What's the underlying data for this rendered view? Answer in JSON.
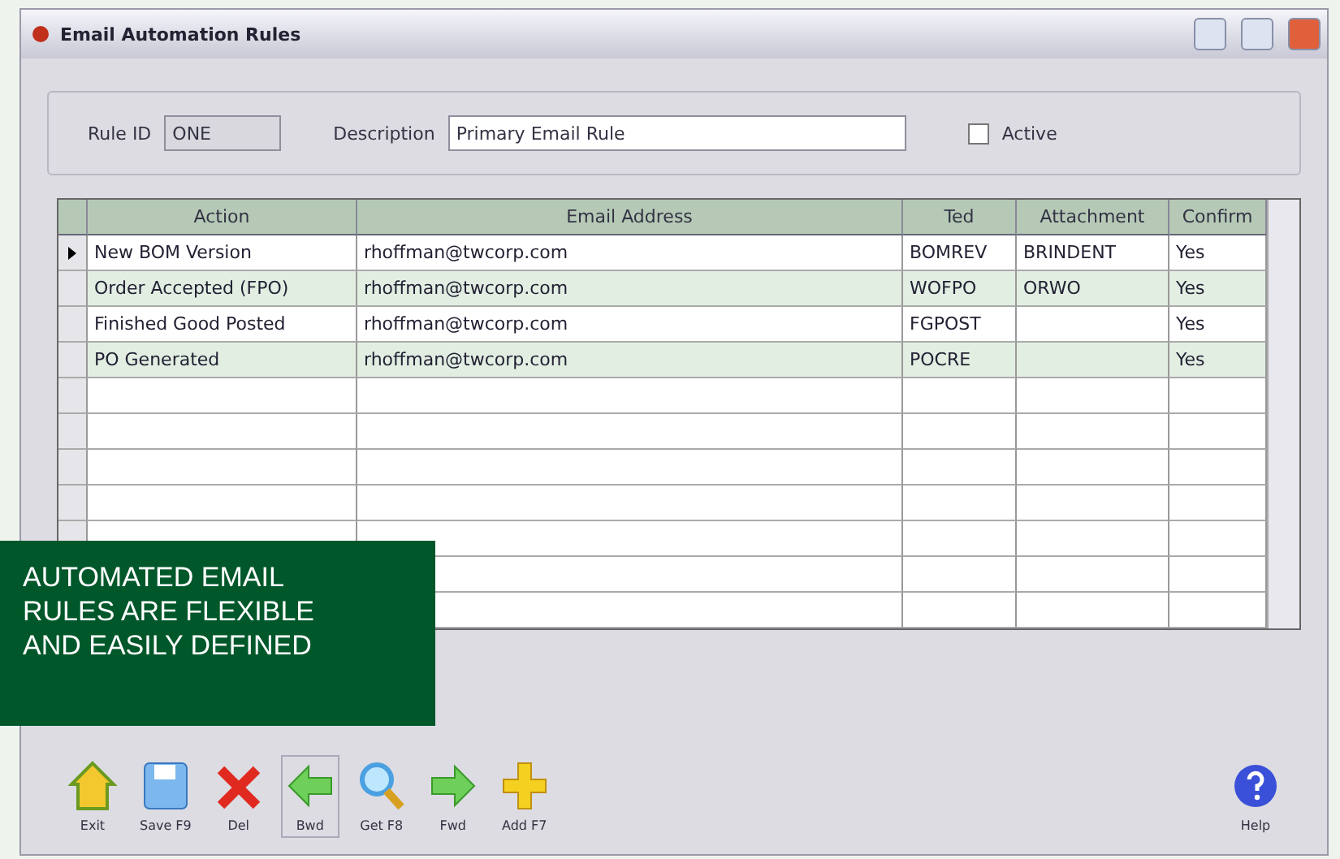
{
  "window": {
    "title": "Email Automation Rules"
  },
  "header": {
    "rule_id_label": "Rule ID",
    "rule_id": "ONE",
    "description_label": "Description",
    "description": "Primary Email Rule",
    "active_label": "Active",
    "active": false
  },
  "table": {
    "columns": [
      "Action",
      "Email Address",
      "Ted",
      "Attachment",
      "Confirm"
    ],
    "rows": [
      {
        "cells": [
          "New BOM Version",
          "rhoffman@twcorp.com",
          "BOMREV",
          "BRINDENT",
          "Yes"
        ],
        "selected": true
      },
      {
        "cells": [
          "Order Accepted (FPO)",
          "rhoffman@twcorp.com",
          "WOFPO",
          "ORWO",
          "Yes"
        ],
        "selected": false
      },
      {
        "cells": [
          "Finished Good Posted",
          "rhoffman@twcorp.com",
          "FGPOST",
          "",
          "Yes"
        ],
        "selected": false
      },
      {
        "cells": [
          "PO Generated",
          "rhoffman@twcorp.com",
          "POCRE",
          "",
          "Yes"
        ],
        "selected": false
      }
    ]
  },
  "toolbar": [
    {
      "kind": "exit",
      "label": "Exit"
    },
    {
      "kind": "save",
      "label": "Save F9"
    },
    {
      "kind": "delete",
      "label": "Del"
    },
    {
      "kind": "back",
      "label": "Bwd"
    },
    {
      "kind": "get",
      "label": "Get F8"
    },
    {
      "kind": "forward",
      "label": "Fwd"
    },
    {
      "kind": "add",
      "label": "Add F7"
    }
  ],
  "help": {
    "label": "Help"
  },
  "caption": [
    "AUTOMATED EMAIL",
    "RULES ARE FLEXIBLE",
    "AND EASILY DEFINED"
  ]
}
